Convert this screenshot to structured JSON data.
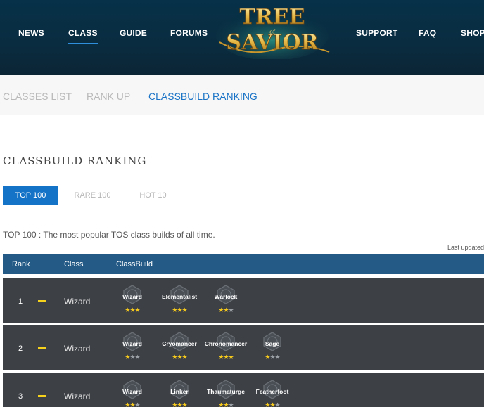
{
  "header": {
    "nav": [
      {
        "label": "NEWS",
        "active": false
      },
      {
        "label": "CLASS",
        "active": true
      },
      {
        "label": "GUIDE",
        "active": false
      },
      {
        "label": "FORUMS",
        "active": false
      },
      {
        "label": "SUPPORT",
        "active": false
      },
      {
        "label": "FAQ",
        "active": false
      },
      {
        "label": "SHOP",
        "active": false
      }
    ],
    "logo": {
      "line1": "TREE",
      "line2": "SAVIOR",
      "connector": "of"
    }
  },
  "subnav": [
    {
      "label": "CLASSES LIST",
      "active": false
    },
    {
      "label": "RANK UP",
      "active": false
    },
    {
      "label": "CLASSBUILD RANKING",
      "active": true
    }
  ],
  "page_title": "CLASSBUILD RANKING",
  "filters": [
    {
      "label": "TOP 100",
      "active": true
    },
    {
      "label": "RARE 100",
      "active": false
    },
    {
      "label": "HOT 10",
      "active": false
    }
  ],
  "description": "TOP 100 : The most popular TOS class builds of all time.",
  "last_updated": "Last updated",
  "table": {
    "headers": {
      "rank": "Rank",
      "class": "Class",
      "build": "ClassBuild"
    },
    "rows": [
      {
        "rank": "1",
        "class": "Wizard",
        "builds": [
          {
            "name": "Wizard",
            "stars": 3
          },
          {
            "name": "Elementalist",
            "stars": 3
          },
          {
            "name": "Warlock",
            "stars": 2
          }
        ]
      },
      {
        "rank": "2",
        "class": "Wizard",
        "builds": [
          {
            "name": "Wizard",
            "stars": 1
          },
          {
            "name": "Cryomancer",
            "stars": 3
          },
          {
            "name": "Chronomancer",
            "stars": 3
          },
          {
            "name": "Sage",
            "stars": 1
          }
        ]
      },
      {
        "rank": "3",
        "class": "Wizard",
        "builds": [
          {
            "name": "Wizard",
            "stars": 2
          },
          {
            "name": "Linker",
            "stars": 3
          },
          {
            "name": "Thaumaturge",
            "stars": 2
          },
          {
            "name": "Featherfoot",
            "stars": 2
          }
        ]
      }
    ]
  },
  "colors": {
    "accent": "#1573c7",
    "header_bg": "#063148",
    "row_bg": "#3d4045",
    "table_head": "#235a86",
    "star": "#f4c81c"
  }
}
